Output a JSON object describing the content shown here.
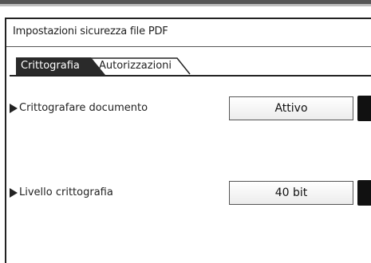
{
  "window": {
    "title": "Impostazioni sicurezza file PDF"
  },
  "tabs": [
    {
      "label": "Crittografia",
      "active": true
    },
    {
      "label": "Autorizzazioni",
      "active": false
    }
  ],
  "settings": [
    {
      "label": "Crittografare documento",
      "value": "Attivo"
    },
    {
      "label": "Livello crittografia",
      "value": "40 bit"
    }
  ],
  "colors": {
    "active_tab_bg": "#2a2a2a",
    "active_tab_text": "#ffffff",
    "side_button": "#111111"
  }
}
